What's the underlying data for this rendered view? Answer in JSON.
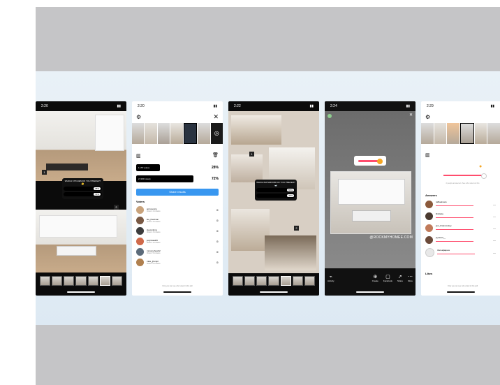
{
  "phones": [
    {
      "time": "2:20",
      "poll_question": "WHICH KITCHEN DO YOU PREFER? 🤔",
      "poll_options": [
        {
          "pct": "28%"
        },
        {
          "pct": "72%"
        }
      ],
      "tags": [
        "1",
        "2"
      ]
    },
    {
      "time": "2:20",
      "close_glyph": "✕",
      "count": "",
      "bars": [
        {
          "label": "1 (75 votes)",
          "pct": "28%"
        },
        {
          "label": "2 (190 votes)",
          "pct": "72%"
        }
      ],
      "share_label": "Share results",
      "section_voters": "Voters",
      "voters": [
        {
          "name": "amrosonny",
          "sub": "Voted • 2 minutes"
        },
        {
          "name": "ika_friedman",
          "sub": "Voted • 3 minutes"
        },
        {
          "name": "stevenlong",
          "sub": "Voted • 3 minutes"
        },
        {
          "name": "judyshaw83",
          "sub": "Voted • 4 minutes"
        },
        {
          "name": "mrsomehow42",
          "sub": "Voted • 5 minutes"
        },
        {
          "name": "mike_jhompl",
          "sub": "Voted • 6 minutes"
        }
      ],
      "footer": "Only you can see who voted in this poll"
    },
    {
      "time": "2:22",
      "poll_question": "WHICH BATHROOM DO YOU PREFER? 🛁",
      "poll_options": [
        {
          "pct": "55%"
        },
        {
          "pct": "45%"
        }
      ],
      "tags": [
        "1",
        "2"
      ]
    },
    {
      "time": "2:24",
      "watermark": "@ROCKMYHOMEE.COM",
      "toolbar": [
        "Activity",
        "Create",
        "Facebook",
        "Share",
        "More"
      ]
    },
    {
      "time": "2:29",
      "slider_caption": "2 people answered • See who voted on this",
      "section_answers": "Answers",
      "answers": [
        {
          "name": "rafhaelmelo"
        },
        {
          "name": "lilmfanie"
        },
        {
          "name": "jeni_fridemonkey"
        },
        {
          "name": "joyheart__"
        },
        {
          "name": "therealjaques"
        }
      ],
      "section_likes": "Likes",
      "footer": "Only you can see who voted in this poll"
    }
  ],
  "colors": {
    "accent": "#3897f0",
    "slider": "#ff4d6d",
    "slider_knob": "#f5a623"
  }
}
